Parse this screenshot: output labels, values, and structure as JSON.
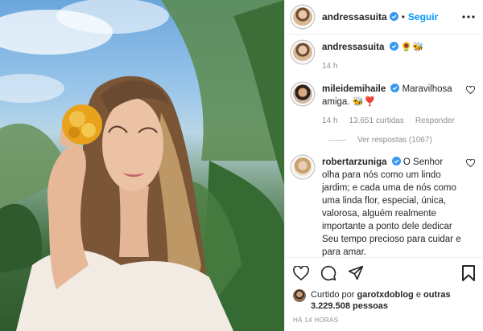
{
  "post": {
    "author": "andressasuita",
    "follow_label": "Seguir",
    "caption": {
      "username": "andressasuita",
      "text": "🌻🐝",
      "time": "14 h"
    },
    "comments": [
      {
        "username": "mileidemihaile",
        "text": "Maravilhosa amiga. 🐝❣️",
        "time": "14 h",
        "likes": "13.651 curtidas",
        "reply_label": "Responder",
        "view_replies": "Ver respostas (1067)"
      },
      {
        "username": "robertarzuniga",
        "text": "O Senhor olha para nós como um lindo jardim; e cada uma de nós como uma linda flor, especial, única, valorosa, alguém realmente importante a ponto dele dedicar Seu tempo precioso para cuidar e para amar."
      }
    ],
    "liked_by": {
      "prefix": "Curtido por",
      "user": "garotxdoblog",
      "connector": "e",
      "others": "outras 3.229.508 pessoas"
    },
    "timestamp": "HÁ 14 HORAS"
  },
  "colors": {
    "accent": "#0095f6",
    "verified": "#3897f0",
    "muted": "#8e8e8e"
  }
}
